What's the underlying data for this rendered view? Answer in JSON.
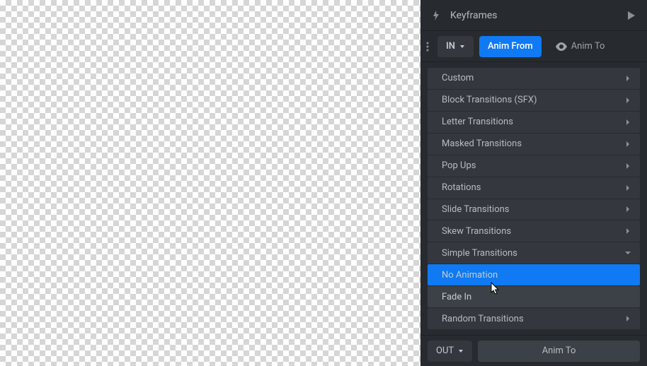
{
  "header": {
    "title": "Keyframes"
  },
  "tabs": {
    "in_label": "IN",
    "anim_from": "Anim From",
    "anim_to": "Anim To"
  },
  "categories": [
    {
      "label": "Custom",
      "expandable": true
    },
    {
      "label": "Block Transitions (SFX)",
      "expandable": true
    },
    {
      "label": "Letter Transitions",
      "expandable": true
    },
    {
      "label": "Masked Transitions",
      "expandable": true
    },
    {
      "label": "Pop Ups",
      "expandable": true
    },
    {
      "label": "Rotations",
      "expandable": true
    },
    {
      "label": "Slide Transitions",
      "expandable": true
    },
    {
      "label": "Skew Transitions",
      "expandable": true
    },
    {
      "label": "Simple Transitions",
      "expandable": true,
      "expanded": true,
      "children": [
        {
          "label": "No Animation",
          "selected": true
        },
        {
          "label": "Fade In"
        }
      ]
    },
    {
      "label": "Random Transitions",
      "expandable": true
    }
  ],
  "footer": {
    "out_label": "OUT",
    "anim_to": "Anim To"
  },
  "colors": {
    "accent": "#0f7af4",
    "panel": "#272b30",
    "row": "#34383e"
  }
}
